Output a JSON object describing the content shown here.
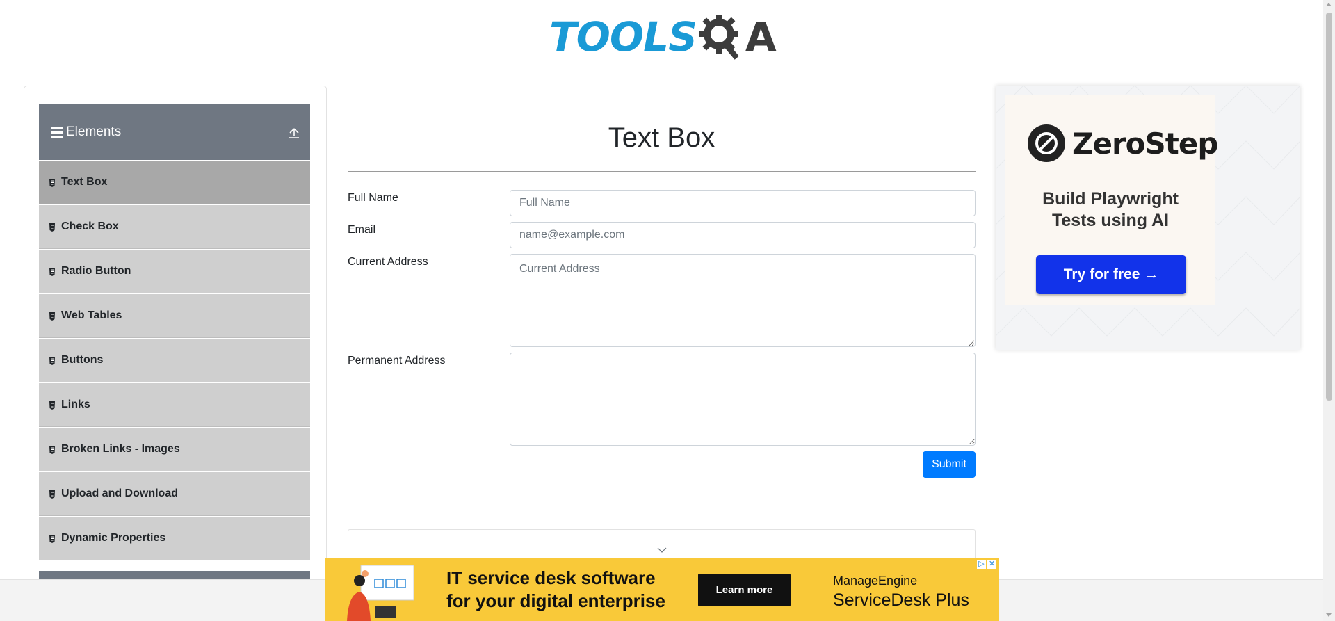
{
  "header": {
    "logo_text": "TOOLS",
    "logo_tail": "A"
  },
  "sidebar": {
    "group_title": "Elements",
    "items": [
      {
        "label": "Text Box",
        "active": true
      },
      {
        "label": "Check Box"
      },
      {
        "label": "Radio Button"
      },
      {
        "label": "Web Tables"
      },
      {
        "label": "Buttons"
      },
      {
        "label": "Links"
      },
      {
        "label": "Broken Links - Images"
      },
      {
        "label": "Upload and Download"
      },
      {
        "label": "Dynamic Properties"
      }
    ]
  },
  "main": {
    "title": "Text Box",
    "fields": {
      "full_name": {
        "label": "Full Name",
        "placeholder": "Full Name",
        "value": ""
      },
      "email": {
        "label": "Email",
        "placeholder": "name@example.com",
        "value": ""
      },
      "current_address": {
        "label": "Current Address",
        "placeholder": "Current Address",
        "value": ""
      },
      "permanent_address": {
        "label": "Permanent Address",
        "placeholder": "",
        "value": ""
      }
    },
    "submit_label": "Submit"
  },
  "ad_right": {
    "brand": "ZeroStep",
    "tagline_line1": "Build Playwright",
    "tagline_line2": "Tests using AI",
    "cta": "Try for free →"
  },
  "banner_ad": {
    "headline_line1": "IT service desk software",
    "headline_line2": "for your digital enterprise",
    "cta": "Learn more",
    "brand_line1": "ManageEngine",
    "brand_line2": "ServiceDesk Plus",
    "adchoices_icon": "▷",
    "close_icon": "✕"
  },
  "colors": {
    "primary": "#007bff",
    "logo_blue": "#1a9ad6",
    "sidebar_header": "#6f7782",
    "menu_item": "#cfcfcf",
    "menu_item_active": "#a8a8a8",
    "banner_bg": "#f9c939",
    "zerostep_button": "#1233ea"
  }
}
